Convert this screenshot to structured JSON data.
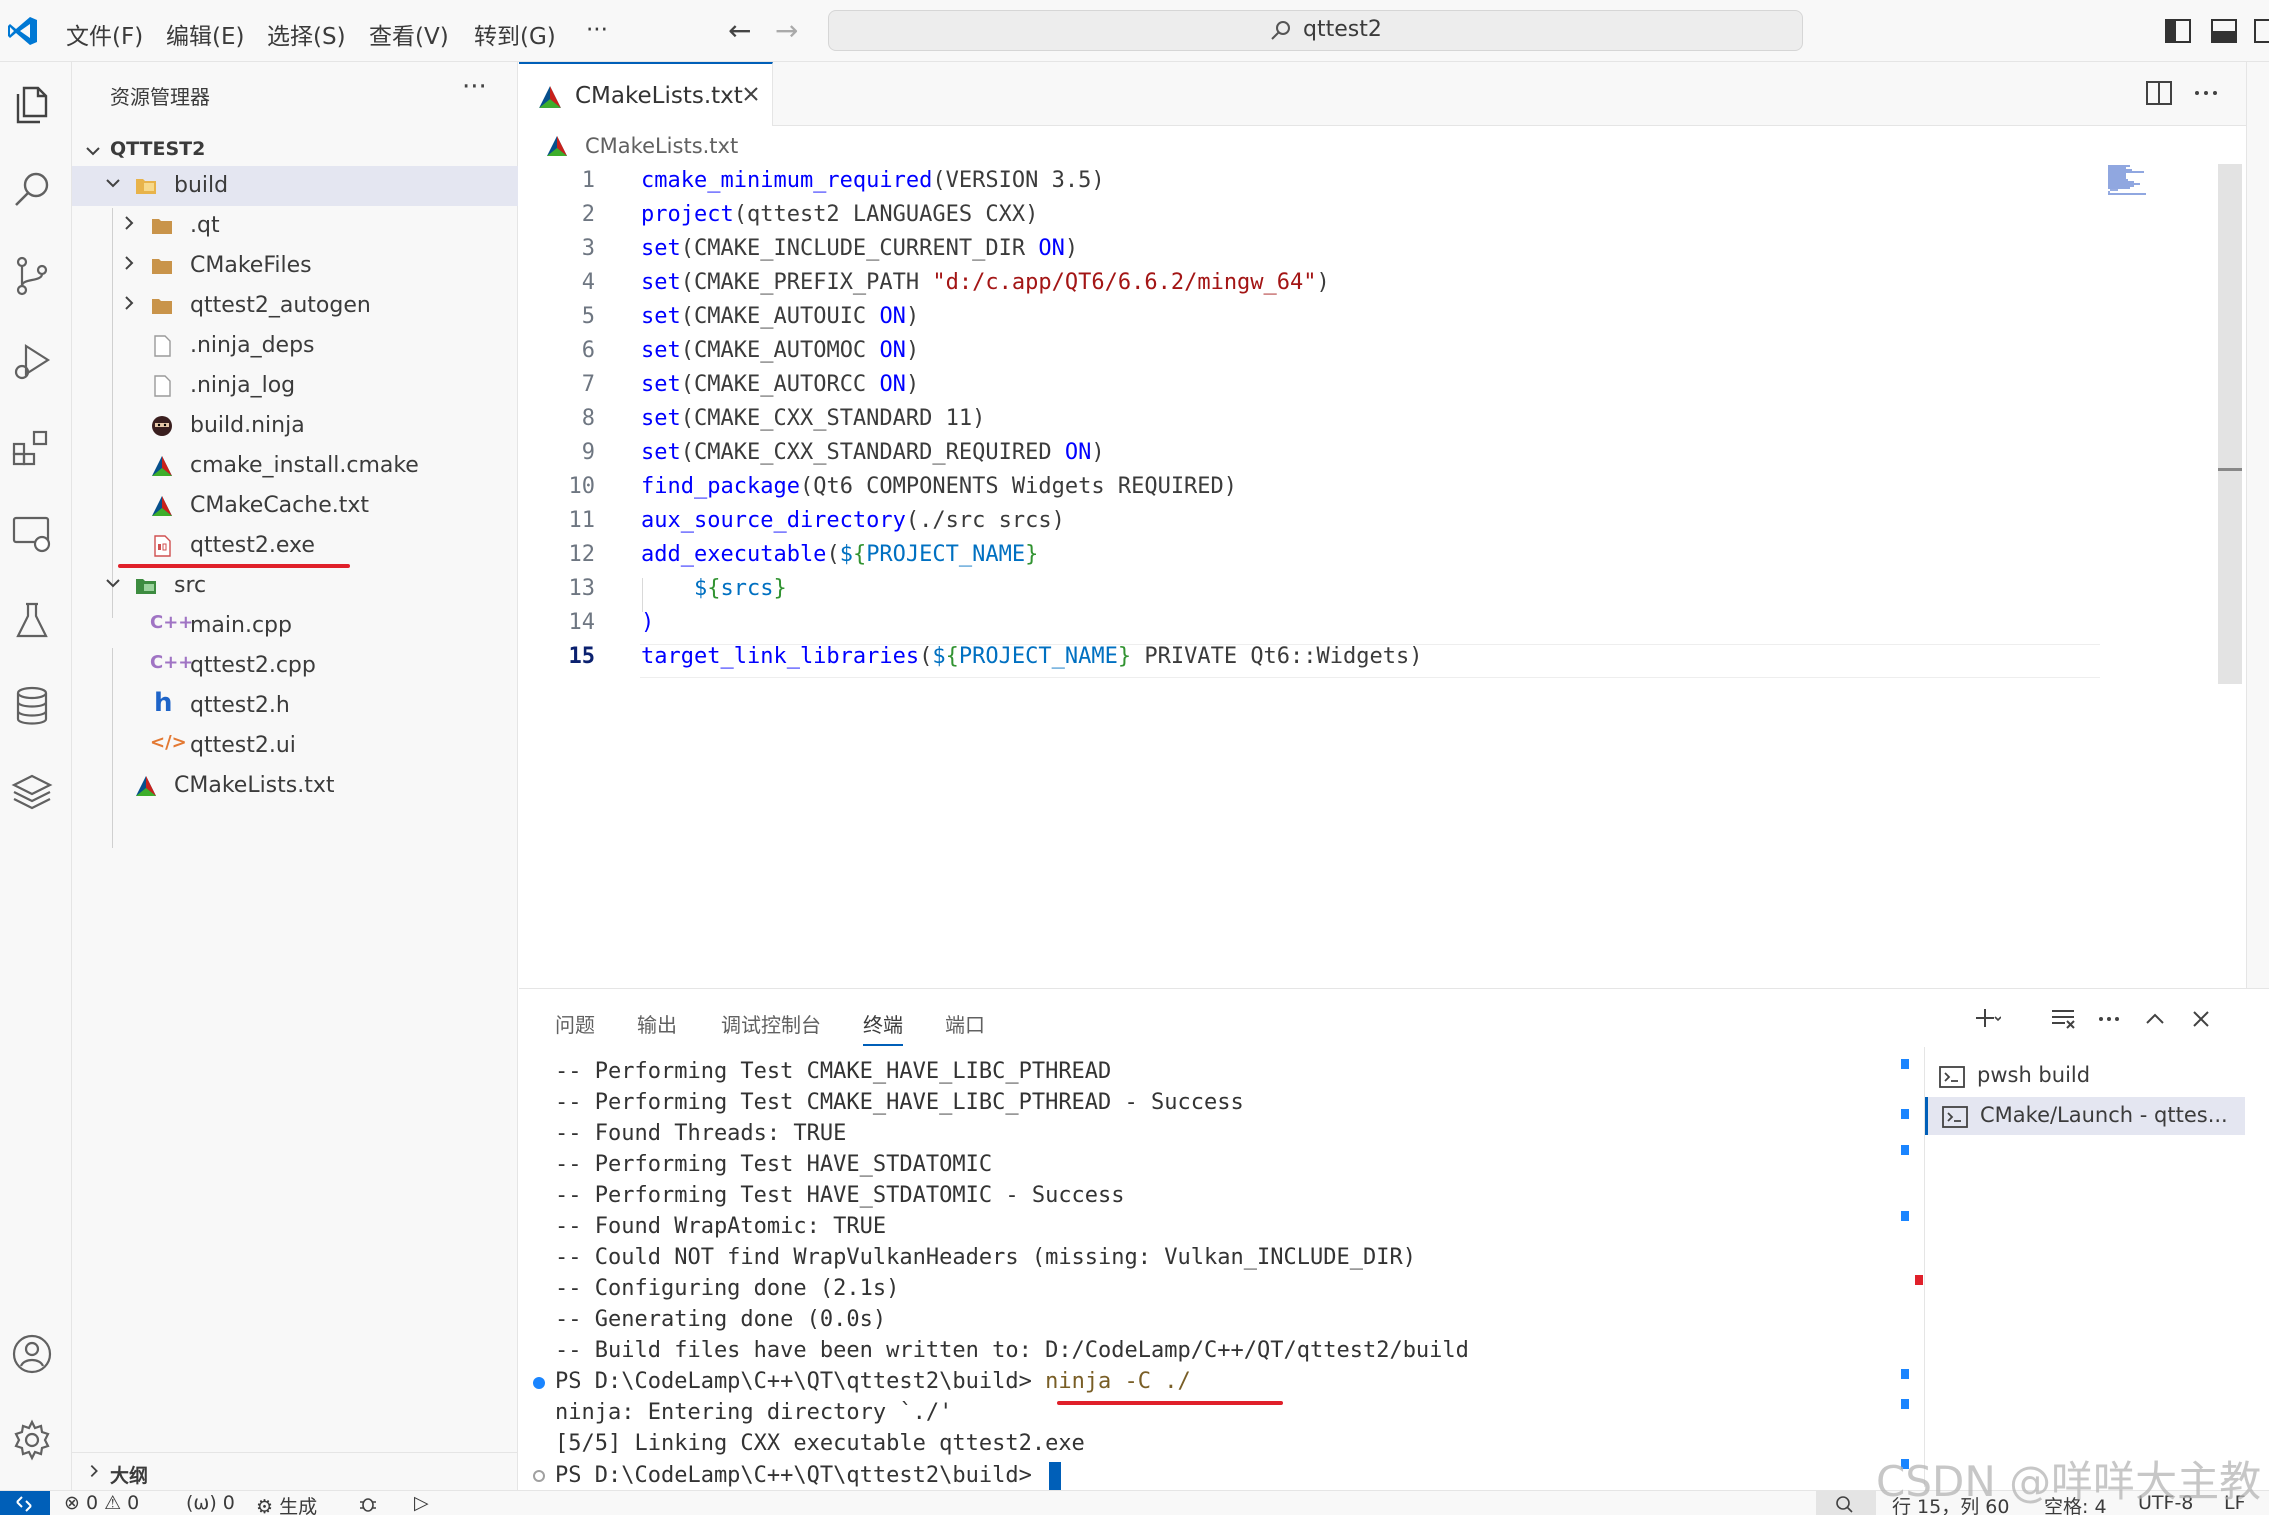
{
  "titlebar": {
    "menus": [
      "文件(F)",
      "编辑(E)",
      "选择(S)",
      "查看(V)",
      "转到(G)",
      "···"
    ],
    "back_arrow": "←",
    "forward_arrow": "→",
    "search_text": "qttest2"
  },
  "activitybar": {
    "icons": [
      "files-icon",
      "search-icon",
      "source-control-icon",
      "run-debug-icon",
      "extensions-icon",
      "remote-explorer-icon",
      "testing-icon",
      "database-icon",
      "layers-icon",
      "account-icon",
      "settings-gear-icon"
    ]
  },
  "sidebar": {
    "title": "资源管理器",
    "more": "···",
    "project": "QTTEST2",
    "tree": [
      {
        "label": "build",
        "kind": "folder-open"
      },
      {
        "label": ".qt",
        "kind": "folder"
      },
      {
        "label": "CMakeFiles",
        "kind": "folder"
      },
      {
        "label": "qttest2_autogen",
        "kind": "folder"
      },
      {
        "label": ".ninja_deps",
        "kind": "file"
      },
      {
        "label": ".ninja_log",
        "kind": "file"
      },
      {
        "label": "build.ninja",
        "kind": "ninja"
      },
      {
        "label": "cmake_install.cmake",
        "kind": "cmake"
      },
      {
        "label": "CMakeCache.txt",
        "kind": "cmake"
      },
      {
        "label": "qttest2.exe",
        "kind": "exe"
      },
      {
        "label": "src",
        "kind": "folder-open"
      },
      {
        "label": "main.cpp",
        "kind": "cpp"
      },
      {
        "label": "qttest2.cpp",
        "kind": "cpp"
      },
      {
        "label": "qttest2.h",
        "kind": "h"
      },
      {
        "label": "qttest2.ui",
        "kind": "ui"
      },
      {
        "label": "CMakeLists.txt",
        "kind": "cmake"
      }
    ],
    "outline": "大纲"
  },
  "editor": {
    "tab_label": "CMakeLists.txt",
    "breadcrumb": "CMakeLists.txt",
    "line_numbers": [
      "1",
      "2",
      "3",
      "4",
      "5",
      "6",
      "7",
      "8",
      "9",
      "10",
      "11",
      "12",
      "13",
      "14",
      "15"
    ],
    "current_line": 15
  },
  "panel": {
    "tabs": [
      "问题",
      "输出",
      "调试控制台",
      "终端",
      "端口"
    ],
    "active_tab": "终端",
    "terminal_lines": [
      "-- Performing Test CMAKE_HAVE_LIBC_PTHREAD",
      "-- Performing Test CMAKE_HAVE_LIBC_PTHREAD - Success",
      "-- Found Threads: TRUE",
      "-- Performing Test HAVE_STDATOMIC",
      "-- Performing Test HAVE_STDATOMIC - Success",
      "-- Found WrapAtomic: TRUE",
      "-- Could NOT find WrapVulkanHeaders (missing: Vulkan_INCLUDE_DIR)",
      "-- Configuring done (2.1s)",
      "-- Generating done (0.0s)",
      "-- Build files have been written to: D:/CodeLamp/C++/QT/qttest2/build"
    ],
    "prompt": "PS D:\\CodeLamp\\C++\\QT\\qttest2\\build> ",
    "command": "ninja -C ./",
    "output_lines": [
      "ninja: Entering directory `./'",
      "[5/5] Linking CXX executable qttest2.exe"
    ],
    "final_prompt": "PS D:\\CodeLamp\\C++\\QT\\qttest2\\build> ",
    "terminals": [
      "pwsh  build",
      "CMake/Launch - qttes..."
    ]
  },
  "statusbar": {
    "errors": "⊗ 0 ⚠ 0",
    "ports": "(ω) 0",
    "build": "⚙ 生成",
    "debug_icon": "bug-icon",
    "run_icon": "▷",
    "position": "行 15，列 60",
    "spaces": "空格: 4",
    "encoding": "UTF-8",
    "eol": "LF"
  },
  "watermark": "CSDN @咩咩大主教",
  "colors": {
    "accent": "#005fb8",
    "keyword": "#0000ff",
    "string": "#a31515",
    "annotation_red": "#e0202a"
  }
}
